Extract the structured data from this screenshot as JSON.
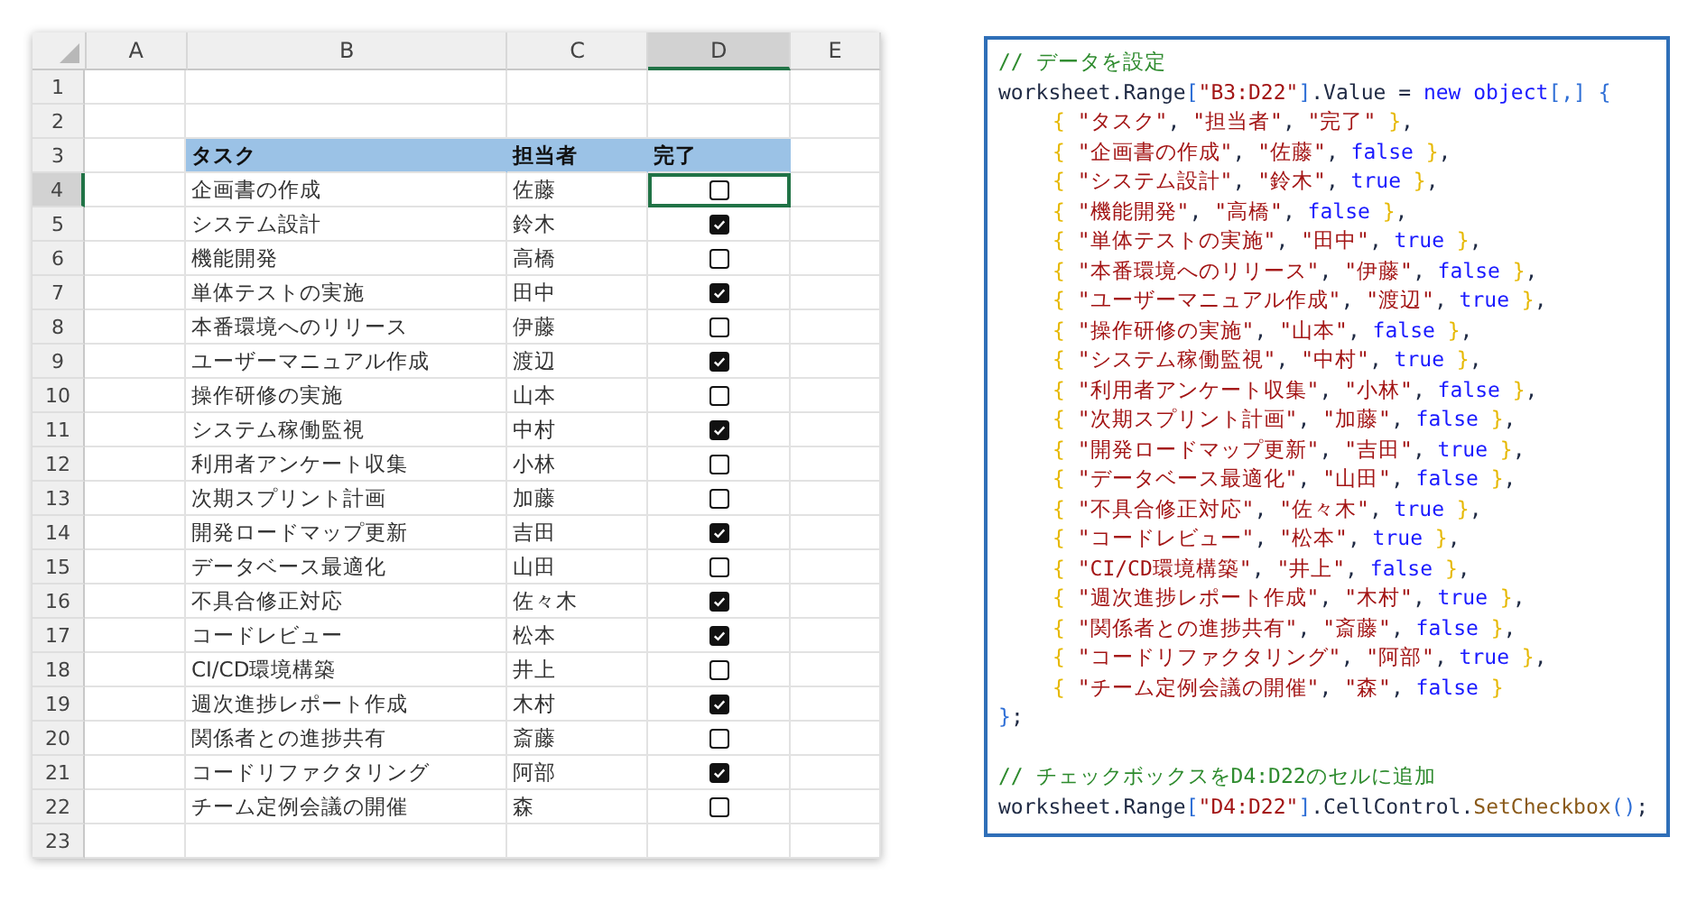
{
  "sheet": {
    "columns": [
      {
        "label": "A",
        "selected": false
      },
      {
        "label": "B",
        "selected": false
      },
      {
        "label": "C",
        "selected": false
      },
      {
        "label": "D",
        "selected": true
      },
      {
        "label": "E",
        "selected": false
      }
    ],
    "rows": [
      {
        "number": "1",
        "kind": "empty",
        "selected": false
      },
      {
        "number": "2",
        "kind": "empty",
        "selected": false
      },
      {
        "number": "3",
        "kind": "header",
        "selected": false,
        "task": "タスク",
        "owner": "担当者",
        "done_label": "完了"
      },
      {
        "number": "4",
        "kind": "task",
        "selected": true,
        "task": "企画書の作成",
        "owner": "佐藤",
        "done": false
      },
      {
        "number": "5",
        "kind": "task",
        "selected": false,
        "task": "システム設計",
        "owner": "鈴木",
        "done": true
      },
      {
        "number": "6",
        "kind": "task",
        "selected": false,
        "task": "機能開発",
        "owner": "高橋",
        "done": false
      },
      {
        "number": "7",
        "kind": "task",
        "selected": false,
        "task": "単体テストの実施",
        "owner": "田中",
        "done": true
      },
      {
        "number": "8",
        "kind": "task",
        "selected": false,
        "task": "本番環境へのリリース",
        "owner": "伊藤",
        "done": false
      },
      {
        "number": "9",
        "kind": "task",
        "selected": false,
        "task": "ユーザーマニュアル作成",
        "owner": "渡辺",
        "done": true
      },
      {
        "number": "10",
        "kind": "task",
        "selected": false,
        "task": "操作研修の実施",
        "owner": "山本",
        "done": false
      },
      {
        "number": "11",
        "kind": "task",
        "selected": false,
        "task": "システム稼働監視",
        "owner": "中村",
        "done": true
      },
      {
        "number": "12",
        "kind": "task",
        "selected": false,
        "task": "利用者アンケート収集",
        "owner": "小林",
        "done": false
      },
      {
        "number": "13",
        "kind": "task",
        "selected": false,
        "task": "次期スプリント計画",
        "owner": "加藤",
        "done": false
      },
      {
        "number": "14",
        "kind": "task",
        "selected": false,
        "task": "開発ロードマップ更新",
        "owner": "吉田",
        "done": true
      },
      {
        "number": "15",
        "kind": "task",
        "selected": false,
        "task": "データベース最適化",
        "owner": "山田",
        "done": false
      },
      {
        "number": "16",
        "kind": "task",
        "selected": false,
        "task": "不具合修正対応",
        "owner": "佐々木",
        "done": true
      },
      {
        "number": "17",
        "kind": "task",
        "selected": false,
        "task": "コードレビュー",
        "owner": "松本",
        "done": true
      },
      {
        "number": "18",
        "kind": "task",
        "selected": false,
        "task": "CI/CD環境構築",
        "owner": "井上",
        "done": false
      },
      {
        "number": "19",
        "kind": "task",
        "selected": false,
        "task": "週次進捗レポート作成",
        "owner": "木村",
        "done": true
      },
      {
        "number": "20",
        "kind": "task",
        "selected": false,
        "task": "関係者との進捗共有",
        "owner": "斎藤",
        "done": false
      },
      {
        "number": "21",
        "kind": "task",
        "selected": false,
        "task": "コードリファクタリング",
        "owner": "阿部",
        "done": true
      },
      {
        "number": "22",
        "kind": "task",
        "selected": false,
        "task": "チーム定例会議の開催",
        "owner": "森",
        "done": false
      },
      {
        "number": "23",
        "kind": "empty",
        "selected": false
      }
    ]
  },
  "code": {
    "blocks": [
      {
        "lines": [
          {
            "indent": false,
            "tokens": [
              {
                "kind": "comment",
                "text": "// データを設定"
              }
            ]
          },
          {
            "indent": false,
            "tokens": [
              {
                "kind": "plain",
                "text": "worksheet.Range"
              },
              {
                "kind": "punct",
                "text": "["
              },
              {
                "kind": "string",
                "text": "\"B3:D22\""
              },
              {
                "kind": "punct",
                "text": "]"
              },
              {
                "kind": "plain",
                "text": ".Value = "
              },
              {
                "kind": "keyword",
                "text": "new object"
              },
              {
                "kind": "punct",
                "text": "[,] {"
              }
            ]
          },
          {
            "indent": true,
            "tokens": [
              {
                "kind": "brace",
                "text": "{ "
              },
              {
                "kind": "string",
                "text": "\"タスク\""
              },
              {
                "kind": "plain",
                "text": ", "
              },
              {
                "kind": "string",
                "text": "\"担当者\""
              },
              {
                "kind": "plain",
                "text": ", "
              },
              {
                "kind": "string",
                "text": "\"完了\""
              },
              {
                "kind": "brace",
                "text": " }"
              },
              {
                "kind": "plain",
                "text": ","
              }
            ]
          },
          {
            "indent": true,
            "tokens": [
              {
                "kind": "brace",
                "text": "{ "
              },
              {
                "kind": "string",
                "text": "\"企画書の作成\""
              },
              {
                "kind": "plain",
                "text": ", "
              },
              {
                "kind": "string",
                "text": "\"佐藤\""
              },
              {
                "kind": "plain",
                "text": ", "
              },
              {
                "kind": "keyword",
                "text": "false"
              },
              {
                "kind": "brace",
                "text": " }"
              },
              {
                "kind": "plain",
                "text": ","
              }
            ]
          },
          {
            "indent": true,
            "tokens": [
              {
                "kind": "brace",
                "text": "{ "
              },
              {
                "kind": "string",
                "text": "\"システム設計\""
              },
              {
                "kind": "plain",
                "text": ", "
              },
              {
                "kind": "string",
                "text": "\"鈴木\""
              },
              {
                "kind": "plain",
                "text": ", "
              },
              {
                "kind": "keyword",
                "text": "true"
              },
              {
                "kind": "brace",
                "text": " }"
              },
              {
                "kind": "plain",
                "text": ","
              }
            ]
          },
          {
            "indent": true,
            "tokens": [
              {
                "kind": "brace",
                "text": "{ "
              },
              {
                "kind": "string",
                "text": "\"機能開発\""
              },
              {
                "kind": "plain",
                "text": ", "
              },
              {
                "kind": "string",
                "text": "\"高橋\""
              },
              {
                "kind": "plain",
                "text": ", "
              },
              {
                "kind": "keyword",
                "text": "false"
              },
              {
                "kind": "brace",
                "text": " }"
              },
              {
                "kind": "plain",
                "text": ","
              }
            ]
          },
          {
            "indent": true,
            "tokens": [
              {
                "kind": "brace",
                "text": "{ "
              },
              {
                "kind": "string",
                "text": "\"単体テストの実施\""
              },
              {
                "kind": "plain",
                "text": ", "
              },
              {
                "kind": "string",
                "text": "\"田中\""
              },
              {
                "kind": "plain",
                "text": ", "
              },
              {
                "kind": "keyword",
                "text": "true"
              },
              {
                "kind": "brace",
                "text": " }"
              },
              {
                "kind": "plain",
                "text": ","
              }
            ]
          },
          {
            "indent": true,
            "tokens": [
              {
                "kind": "brace",
                "text": "{ "
              },
              {
                "kind": "string",
                "text": "\"本番環境へのリリース\""
              },
              {
                "kind": "plain",
                "text": ", "
              },
              {
                "kind": "string",
                "text": "\"伊藤\""
              },
              {
                "kind": "plain",
                "text": ", "
              },
              {
                "kind": "keyword",
                "text": "false"
              },
              {
                "kind": "brace",
                "text": " }"
              },
              {
                "kind": "plain",
                "text": ","
              }
            ]
          },
          {
            "indent": true,
            "tokens": [
              {
                "kind": "brace",
                "text": "{ "
              },
              {
                "kind": "string",
                "text": "\"ユーザーマニュアル作成\""
              },
              {
                "kind": "plain",
                "text": ", "
              },
              {
                "kind": "string",
                "text": "\"渡辺\""
              },
              {
                "kind": "plain",
                "text": ", "
              },
              {
                "kind": "keyword",
                "text": "true"
              },
              {
                "kind": "brace",
                "text": " }"
              },
              {
                "kind": "plain",
                "text": ","
              }
            ]
          },
          {
            "indent": true,
            "tokens": [
              {
                "kind": "brace",
                "text": "{ "
              },
              {
                "kind": "string",
                "text": "\"操作研修の実施\""
              },
              {
                "kind": "plain",
                "text": ", "
              },
              {
                "kind": "string",
                "text": "\"山本\""
              },
              {
                "kind": "plain",
                "text": ", "
              },
              {
                "kind": "keyword",
                "text": "false"
              },
              {
                "kind": "brace",
                "text": " }"
              },
              {
                "kind": "plain",
                "text": ","
              }
            ]
          },
          {
            "indent": true,
            "tokens": [
              {
                "kind": "brace",
                "text": "{ "
              },
              {
                "kind": "string",
                "text": "\"システム稼働監視\""
              },
              {
                "kind": "plain",
                "text": ", "
              },
              {
                "kind": "string",
                "text": "\"中村\""
              },
              {
                "kind": "plain",
                "text": ", "
              },
              {
                "kind": "keyword",
                "text": "true"
              },
              {
                "kind": "brace",
                "text": " }"
              },
              {
                "kind": "plain",
                "text": ","
              }
            ]
          },
          {
            "indent": true,
            "tokens": [
              {
                "kind": "brace",
                "text": "{ "
              },
              {
                "kind": "string",
                "text": "\"利用者アンケート収集\""
              },
              {
                "kind": "plain",
                "text": ", "
              },
              {
                "kind": "string",
                "text": "\"小林\""
              },
              {
                "kind": "plain",
                "text": ", "
              },
              {
                "kind": "keyword",
                "text": "false"
              },
              {
                "kind": "brace",
                "text": " }"
              },
              {
                "kind": "plain",
                "text": ","
              }
            ]
          },
          {
            "indent": true,
            "tokens": [
              {
                "kind": "brace",
                "text": "{ "
              },
              {
                "kind": "string",
                "text": "\"次期スプリント計画\""
              },
              {
                "kind": "plain",
                "text": ", "
              },
              {
                "kind": "string",
                "text": "\"加藤\""
              },
              {
                "kind": "plain",
                "text": ", "
              },
              {
                "kind": "keyword",
                "text": "false"
              },
              {
                "kind": "brace",
                "text": " }"
              },
              {
                "kind": "plain",
                "text": ","
              }
            ]
          },
          {
            "indent": true,
            "tokens": [
              {
                "kind": "brace",
                "text": "{ "
              },
              {
                "kind": "string",
                "text": "\"開発ロードマップ更新\""
              },
              {
                "kind": "plain",
                "text": ", "
              },
              {
                "kind": "string",
                "text": "\"吉田\""
              },
              {
                "kind": "plain",
                "text": ", "
              },
              {
                "kind": "keyword",
                "text": "true"
              },
              {
                "kind": "brace",
                "text": " }"
              },
              {
                "kind": "plain",
                "text": ","
              }
            ]
          },
          {
            "indent": true,
            "tokens": [
              {
                "kind": "brace",
                "text": "{ "
              },
              {
                "kind": "string",
                "text": "\"データベース最適化\""
              },
              {
                "kind": "plain",
                "text": ", "
              },
              {
                "kind": "string",
                "text": "\"山田\""
              },
              {
                "kind": "plain",
                "text": ", "
              },
              {
                "kind": "keyword",
                "text": "false"
              },
              {
                "kind": "brace",
                "text": " }"
              },
              {
                "kind": "plain",
                "text": ","
              }
            ]
          },
          {
            "indent": true,
            "tokens": [
              {
                "kind": "brace",
                "text": "{ "
              },
              {
                "kind": "string",
                "text": "\"不具合修正対応\""
              },
              {
                "kind": "plain",
                "text": ", "
              },
              {
                "kind": "string",
                "text": "\"佐々木\""
              },
              {
                "kind": "plain",
                "text": ", "
              },
              {
                "kind": "keyword",
                "text": "true"
              },
              {
                "kind": "brace",
                "text": " }"
              },
              {
                "kind": "plain",
                "text": ","
              }
            ]
          },
          {
            "indent": true,
            "tokens": [
              {
                "kind": "brace",
                "text": "{ "
              },
              {
                "kind": "string",
                "text": "\"コードレビュー\""
              },
              {
                "kind": "plain",
                "text": ", "
              },
              {
                "kind": "string",
                "text": "\"松本\""
              },
              {
                "kind": "plain",
                "text": ", "
              },
              {
                "kind": "keyword",
                "text": "true"
              },
              {
                "kind": "brace",
                "text": " }"
              },
              {
                "kind": "plain",
                "text": ","
              }
            ]
          },
          {
            "indent": true,
            "tokens": [
              {
                "kind": "brace",
                "text": "{ "
              },
              {
                "kind": "string",
                "text": "\"CI/CD環境構築\""
              },
              {
                "kind": "plain",
                "text": ", "
              },
              {
                "kind": "string",
                "text": "\"井上\""
              },
              {
                "kind": "plain",
                "text": ", "
              },
              {
                "kind": "keyword",
                "text": "false"
              },
              {
                "kind": "brace",
                "text": " }"
              },
              {
                "kind": "plain",
                "text": ","
              }
            ]
          },
          {
            "indent": true,
            "tokens": [
              {
                "kind": "brace",
                "text": "{ "
              },
              {
                "kind": "string",
                "text": "\"週次進捗レポート作成\""
              },
              {
                "kind": "plain",
                "text": ", "
              },
              {
                "kind": "string",
                "text": "\"木村\""
              },
              {
                "kind": "plain",
                "text": ", "
              },
              {
                "kind": "keyword",
                "text": "true"
              },
              {
                "kind": "brace",
                "text": " }"
              },
              {
                "kind": "plain",
                "text": ","
              }
            ]
          },
          {
            "indent": true,
            "tokens": [
              {
                "kind": "brace",
                "text": "{ "
              },
              {
                "kind": "string",
                "text": "\"関係者との進捗共有\""
              },
              {
                "kind": "plain",
                "text": ", "
              },
              {
                "kind": "string",
                "text": "\"斎藤\""
              },
              {
                "kind": "plain",
                "text": ", "
              },
              {
                "kind": "keyword",
                "text": "false"
              },
              {
                "kind": "brace",
                "text": " }"
              },
              {
                "kind": "plain",
                "text": ","
              }
            ]
          },
          {
            "indent": true,
            "tokens": [
              {
                "kind": "brace",
                "text": "{ "
              },
              {
                "kind": "string",
                "text": "\"コードリファクタリング\""
              },
              {
                "kind": "plain",
                "text": ", "
              },
              {
                "kind": "string",
                "text": "\"阿部\""
              },
              {
                "kind": "plain",
                "text": ", "
              },
              {
                "kind": "keyword",
                "text": "true"
              },
              {
                "kind": "brace",
                "text": " }"
              },
              {
                "kind": "plain",
                "text": ","
              }
            ]
          },
          {
            "indent": true,
            "tokens": [
              {
                "kind": "brace",
                "text": "{ "
              },
              {
                "kind": "string",
                "text": "\"チーム定例会議の開催\""
              },
              {
                "kind": "plain",
                "text": ", "
              },
              {
                "kind": "string",
                "text": "\"森\""
              },
              {
                "kind": "plain",
                "text": ", "
              },
              {
                "kind": "keyword",
                "text": "false"
              },
              {
                "kind": "brace",
                "text": " }"
              }
            ]
          },
          {
            "indent": false,
            "tokens": [
              {
                "kind": "punct",
                "text": "}"
              },
              {
                "kind": "plain",
                "text": ";"
              }
            ]
          }
        ]
      },
      {
        "lines": [
          {
            "indent": false,
            "tokens": [
              {
                "kind": "comment",
                "text": "// チェックボックスをD4:D22のセルに追加"
              }
            ]
          },
          {
            "indent": false,
            "tokens": [
              {
                "kind": "plain",
                "text": "worksheet.Range"
              },
              {
                "kind": "punct",
                "text": "["
              },
              {
                "kind": "string",
                "text": "\"D4:D22\""
              },
              {
                "kind": "punct",
                "text": "]"
              },
              {
                "kind": "plain",
                "text": ".CellControl."
              },
              {
                "kind": "method",
                "text": "SetCheckbox"
              },
              {
                "kind": "punct",
                "text": "()"
              },
              {
                "kind": "plain",
                "text": ";"
              }
            ]
          }
        ]
      }
    ]
  }
}
